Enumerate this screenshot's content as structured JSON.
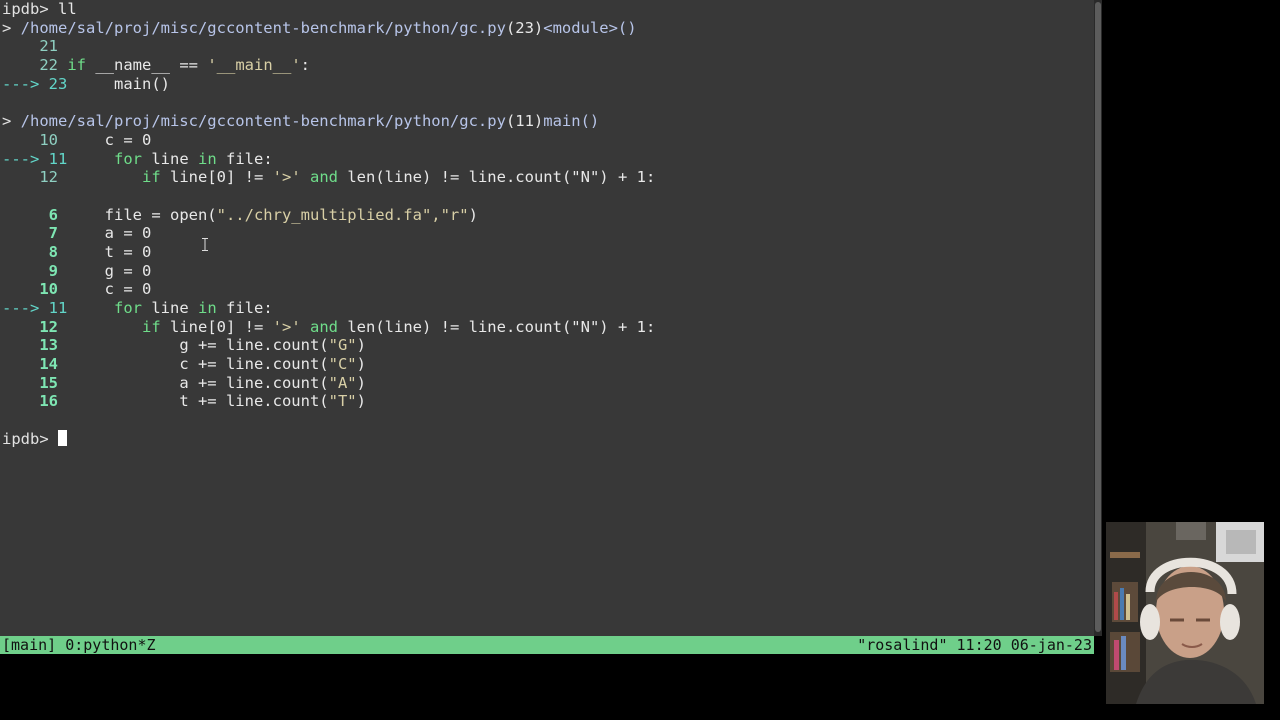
{
  "terminal": {
    "lines": [
      {
        "prompt": "ipdb> ",
        "cmd": "ll"
      },
      {
        "marker": "> ",
        "path": "/home/sal/proj/misc/gccontent-benchmark/python/gc.py",
        "loc": "(23)",
        "func": "<module>()"
      },
      {
        "num": "    21",
        "code": ""
      },
      {
        "num": "    22",
        "code": " ",
        "kw": "if",
        "rest": " __name__ == ",
        "str": "'__main__'",
        "tail": ":"
      },
      {
        "arrow": "---> 23",
        "code": "     main()"
      },
      {
        "blank": true
      },
      {
        "marker": "> ",
        "path": "/home/sal/proj/misc/gccontent-benchmark/python/gc.py",
        "loc": "(11)",
        "func": "main()"
      },
      {
        "num": "    10",
        "code": "     c = 0"
      },
      {
        "arrow": "---> 11",
        "code": "     ",
        "kw": "for",
        "rest": " line ",
        "kw2": "in",
        "tail": " file:"
      },
      {
        "num": "    12",
        "code": "         ",
        "kw": "if",
        "rest": " line[0] != ",
        "str": "'>'",
        "rest2": " ",
        "kw2": "and",
        "tail": " len(line) != line.count(\"N\") + 1:"
      },
      {
        "blank": true
      },
      {
        "bnum": "     6",
        "code": "     file = open(",
        "str": "\"../chry_multiplied.fa\",\"r\"",
        "tail": ")"
      },
      {
        "bnum": "     7",
        "code": "     a = 0"
      },
      {
        "bnum": "     8",
        "code": "     t = 0"
      },
      {
        "bnum": "     9",
        "code": "     g = 0"
      },
      {
        "bnum": "    10",
        "code": "     c = 0"
      },
      {
        "arrow": "---> 11",
        "code": "     ",
        "kw": "for",
        "rest": " line ",
        "kw2": "in",
        "tail": " file:"
      },
      {
        "bnum": "    12",
        "code": "         ",
        "kw": "if",
        "rest": " line[0] != ",
        "str": "'>'",
        "rest2": " ",
        "kw2": "and",
        "tail": " len(line) != line.count(\"N\") + 1:"
      },
      {
        "bnum": "    13",
        "code": "             g += line.count(",
        "str": "\"G\"",
        "tail": ")"
      },
      {
        "bnum": "    14",
        "code": "             c += line.count(",
        "str": "\"C\"",
        "tail": ")"
      },
      {
        "bnum": "    15",
        "code": "             a += line.count(",
        "str": "\"A\"",
        "tail": ")"
      },
      {
        "bnum": "    16",
        "code": "             t += line.count(",
        "str": "\"T\"",
        "tail": ")"
      },
      {
        "blank": true
      },
      {
        "prompt": "ipdb> ",
        "cursor": true
      }
    ]
  },
  "statusbar": {
    "session": "[main]",
    "window": "0:python*Z",
    "host": "\"rosalind\"",
    "time": "11:20",
    "date": "06-jan-23"
  },
  "colors": {
    "terminal_bg": "#383838",
    "status_bg": "#6fcf8a",
    "keyword": "#6fdd8a",
    "string": "#d8cfa6",
    "arrow": "#62d6c9"
  }
}
